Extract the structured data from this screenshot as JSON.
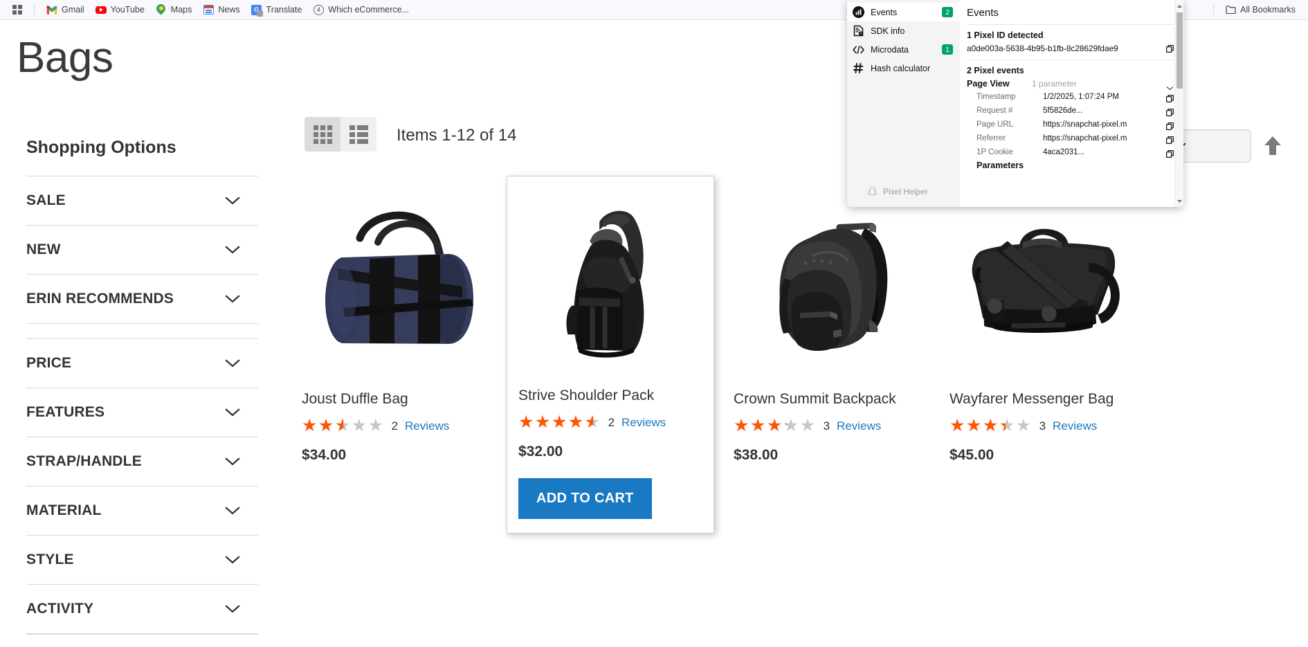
{
  "browser": {
    "apps_icon": "apps-grid-icon",
    "bookmarks": [
      {
        "label": "Gmail",
        "icon": "gmail-icon"
      },
      {
        "label": "YouTube",
        "icon": "youtube-icon"
      },
      {
        "label": "Maps",
        "icon": "maps-pin-icon"
      },
      {
        "label": "News",
        "icon": "news-icon"
      },
      {
        "label": "Translate",
        "icon": "translate-icon"
      },
      {
        "label": "Which eCommerce...",
        "icon": "circle-4-icon"
      }
    ],
    "all_bookmarks_label": "All Bookmarks",
    "all_bookmarks_icon": "folder-icon",
    "bar_bg": "#f9f8fd"
  },
  "page": {
    "title": "Bags"
  },
  "sidebar": {
    "heading": "Shopping Options",
    "filters": [
      {
        "label": "SALE"
      },
      {
        "label": "NEW"
      },
      {
        "label": "ERIN RECOMMENDS"
      },
      {
        "label": "PRICE"
      },
      {
        "label": "FEATURES"
      },
      {
        "label": "STRAP/HANDLE"
      },
      {
        "label": "MATERIAL"
      },
      {
        "label": "STYLE"
      },
      {
        "label": "ACTIVITY"
      }
    ]
  },
  "toolbar": {
    "grid_view_icon": "grid-view-icon",
    "list_view_icon": "list-view-icon",
    "items_count": "Items 1-12 of 14",
    "sort_selected": "",
    "sort_direction_icon": "arrow-up-icon"
  },
  "products": [
    {
      "name": "Joust Duffle Bag",
      "rating": 2.5,
      "rating_pct": "50%",
      "reviews_count": "2",
      "reviews_label": "Reviews",
      "price": "$34.00",
      "image": "navy-duffle-bag",
      "hovered": false,
      "add_to_cart_label": ""
    },
    {
      "name": "Strive Shoulder Pack",
      "rating": 4.5,
      "rating_pct": "90%",
      "reviews_count": "2",
      "reviews_label": "Reviews",
      "price": "$32.00",
      "image": "black-sling-pack",
      "hovered": true,
      "add_to_cart_label": "ADD TO CART"
    },
    {
      "name": "Crown Summit Backpack",
      "rating": 3.2,
      "rating_pct": "64%",
      "reviews_count": "3",
      "reviews_label": "Reviews",
      "price": "$38.00",
      "image": "black-backpack",
      "hovered": false,
      "add_to_cart_label": ""
    },
    {
      "name": "Wayfarer Messenger Bag",
      "rating": 3.4,
      "rating_pct": "68%",
      "reviews_count": "3",
      "reviews_label": "Reviews",
      "price": "$45.00",
      "image": "black-messenger-bag",
      "hovered": false,
      "add_to_cart_label": ""
    }
  ],
  "pixel_helper": {
    "nav": [
      {
        "label": "Events",
        "badge": "2",
        "icon": "bar-chart-icon",
        "active": true
      },
      {
        "label": "SDK info",
        "badge": "",
        "icon": "sdk-document-icon",
        "active": false
      },
      {
        "label": "Microdata",
        "badge": "1",
        "icon": "code-brackets-icon",
        "active": false
      },
      {
        "label": "Hash calculator",
        "badge": "",
        "icon": "hash-icon",
        "active": false
      }
    ],
    "brand_label": "Pixel Helper",
    "brand_icon": "snapchat-ghost-icon",
    "panel_title": "Events",
    "pixel_id_heading": "1 Pixel ID detected",
    "pixel_id": "a0de003a-5638-4b95-b1fb-8c28629fdae9",
    "events_heading": "2 Pixel events",
    "event": {
      "name": "Page View",
      "param_summary": "1 parameter"
    },
    "details": [
      {
        "key": "Timestamp",
        "value": "1/2/2025, 1:07:24 PM",
        "copy": true
      },
      {
        "key": "Request #",
        "value": "5f5826de...",
        "copy": true
      },
      {
        "key": "Page URL",
        "value": "https://snapchat-pixel.m",
        "copy": true
      },
      {
        "key": "Referrer",
        "value": "https://snapchat-pixel.m",
        "copy": true
      },
      {
        "key": "1P Cookie",
        "value": "4aca2031...",
        "copy": true
      }
    ],
    "parameters_label": "Parameters",
    "badge_color": "#00a36c"
  },
  "colors": {
    "star_filled": "#ff5501",
    "star_empty": "#c7c7c7",
    "link": "#1979c3",
    "button": "#1979c3"
  }
}
